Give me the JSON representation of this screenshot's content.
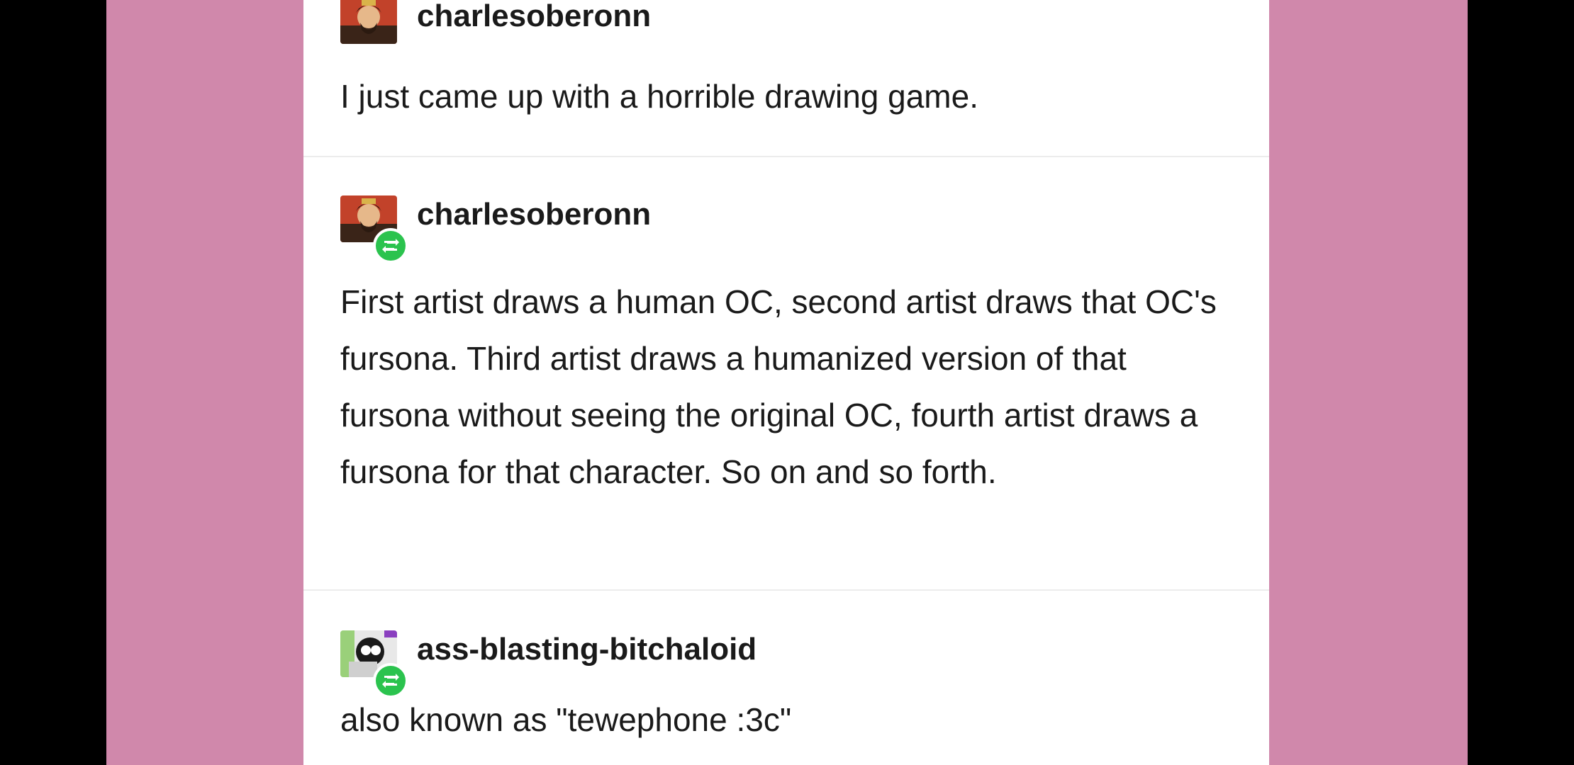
{
  "colors": {
    "page_background": "#d088ab",
    "letterbox": "#000000",
    "card_background": "#ffffff",
    "reblog_badge": "#2bc34e",
    "text": "#1a1a1a"
  },
  "posts": [
    {
      "username": "charlesoberonn",
      "avatar": "charlesoberonn-avatar",
      "text": "I just came up with a horrible drawing game."
    },
    {
      "username": "charlesoberonn",
      "avatar": "charlesoberonn-avatar",
      "reblog_icon": "reblog-icon",
      "text": "First artist draws a human OC, second artist draws that OC's fursona. Third artist draws a humanized version of that fursona without seeing the original OC, fourth artist draws a fursona for that character. So on and so forth."
    },
    {
      "username": "ass-blasting-bitchaloid",
      "avatar": "ass-blasting-bitchaloid-avatar",
      "reblog_icon": "reblog-icon",
      "text": "also known as \"tewephone :3c\""
    }
  ]
}
